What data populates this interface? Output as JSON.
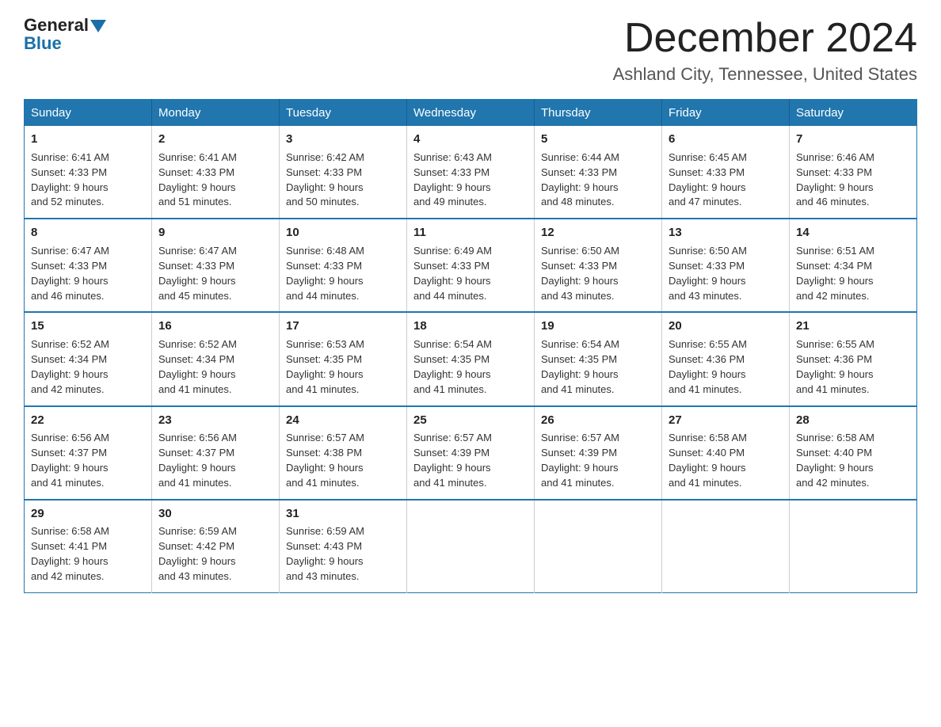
{
  "logo": {
    "general": "General",
    "blue": "Blue"
  },
  "title": "December 2024",
  "subtitle": "Ashland City, Tennessee, United States",
  "days_of_week": [
    "Sunday",
    "Monday",
    "Tuesday",
    "Wednesday",
    "Thursday",
    "Friday",
    "Saturday"
  ],
  "weeks": [
    [
      {
        "day": 1,
        "sunrise": "6:41 AM",
        "sunset": "4:33 PM",
        "daylight": "9 hours and 52 minutes."
      },
      {
        "day": 2,
        "sunrise": "6:41 AM",
        "sunset": "4:33 PM",
        "daylight": "9 hours and 51 minutes."
      },
      {
        "day": 3,
        "sunrise": "6:42 AM",
        "sunset": "4:33 PM",
        "daylight": "9 hours and 50 minutes."
      },
      {
        "day": 4,
        "sunrise": "6:43 AM",
        "sunset": "4:33 PM",
        "daylight": "9 hours and 49 minutes."
      },
      {
        "day": 5,
        "sunrise": "6:44 AM",
        "sunset": "4:33 PM",
        "daylight": "9 hours and 48 minutes."
      },
      {
        "day": 6,
        "sunrise": "6:45 AM",
        "sunset": "4:33 PM",
        "daylight": "9 hours and 47 minutes."
      },
      {
        "day": 7,
        "sunrise": "6:46 AM",
        "sunset": "4:33 PM",
        "daylight": "9 hours and 46 minutes."
      }
    ],
    [
      {
        "day": 8,
        "sunrise": "6:47 AM",
        "sunset": "4:33 PM",
        "daylight": "9 hours and 46 minutes."
      },
      {
        "day": 9,
        "sunrise": "6:47 AM",
        "sunset": "4:33 PM",
        "daylight": "9 hours and 45 minutes."
      },
      {
        "day": 10,
        "sunrise": "6:48 AM",
        "sunset": "4:33 PM",
        "daylight": "9 hours and 44 minutes."
      },
      {
        "day": 11,
        "sunrise": "6:49 AM",
        "sunset": "4:33 PM",
        "daylight": "9 hours and 44 minutes."
      },
      {
        "day": 12,
        "sunrise": "6:50 AM",
        "sunset": "4:33 PM",
        "daylight": "9 hours and 43 minutes."
      },
      {
        "day": 13,
        "sunrise": "6:50 AM",
        "sunset": "4:33 PM",
        "daylight": "9 hours and 43 minutes."
      },
      {
        "day": 14,
        "sunrise": "6:51 AM",
        "sunset": "4:34 PM",
        "daylight": "9 hours and 42 minutes."
      }
    ],
    [
      {
        "day": 15,
        "sunrise": "6:52 AM",
        "sunset": "4:34 PM",
        "daylight": "9 hours and 42 minutes."
      },
      {
        "day": 16,
        "sunrise": "6:52 AM",
        "sunset": "4:34 PM",
        "daylight": "9 hours and 41 minutes."
      },
      {
        "day": 17,
        "sunrise": "6:53 AM",
        "sunset": "4:35 PM",
        "daylight": "9 hours and 41 minutes."
      },
      {
        "day": 18,
        "sunrise": "6:54 AM",
        "sunset": "4:35 PM",
        "daylight": "9 hours and 41 minutes."
      },
      {
        "day": 19,
        "sunrise": "6:54 AM",
        "sunset": "4:35 PM",
        "daylight": "9 hours and 41 minutes."
      },
      {
        "day": 20,
        "sunrise": "6:55 AM",
        "sunset": "4:36 PM",
        "daylight": "9 hours and 41 minutes."
      },
      {
        "day": 21,
        "sunrise": "6:55 AM",
        "sunset": "4:36 PM",
        "daylight": "9 hours and 41 minutes."
      }
    ],
    [
      {
        "day": 22,
        "sunrise": "6:56 AM",
        "sunset": "4:37 PM",
        "daylight": "9 hours and 41 minutes."
      },
      {
        "day": 23,
        "sunrise": "6:56 AM",
        "sunset": "4:37 PM",
        "daylight": "9 hours and 41 minutes."
      },
      {
        "day": 24,
        "sunrise": "6:57 AM",
        "sunset": "4:38 PM",
        "daylight": "9 hours and 41 minutes."
      },
      {
        "day": 25,
        "sunrise": "6:57 AM",
        "sunset": "4:39 PM",
        "daylight": "9 hours and 41 minutes."
      },
      {
        "day": 26,
        "sunrise": "6:57 AM",
        "sunset": "4:39 PM",
        "daylight": "9 hours and 41 minutes."
      },
      {
        "day": 27,
        "sunrise": "6:58 AM",
        "sunset": "4:40 PM",
        "daylight": "9 hours and 41 minutes."
      },
      {
        "day": 28,
        "sunrise": "6:58 AM",
        "sunset": "4:40 PM",
        "daylight": "9 hours and 42 minutes."
      }
    ],
    [
      {
        "day": 29,
        "sunrise": "6:58 AM",
        "sunset": "4:41 PM",
        "daylight": "9 hours and 42 minutes."
      },
      {
        "day": 30,
        "sunrise": "6:59 AM",
        "sunset": "4:42 PM",
        "daylight": "9 hours and 43 minutes."
      },
      {
        "day": 31,
        "sunrise": "6:59 AM",
        "sunset": "4:43 PM",
        "daylight": "9 hours and 43 minutes."
      },
      null,
      null,
      null,
      null
    ]
  ],
  "labels": {
    "sunrise": "Sunrise:",
    "sunset": "Sunset:",
    "daylight": "Daylight:"
  }
}
